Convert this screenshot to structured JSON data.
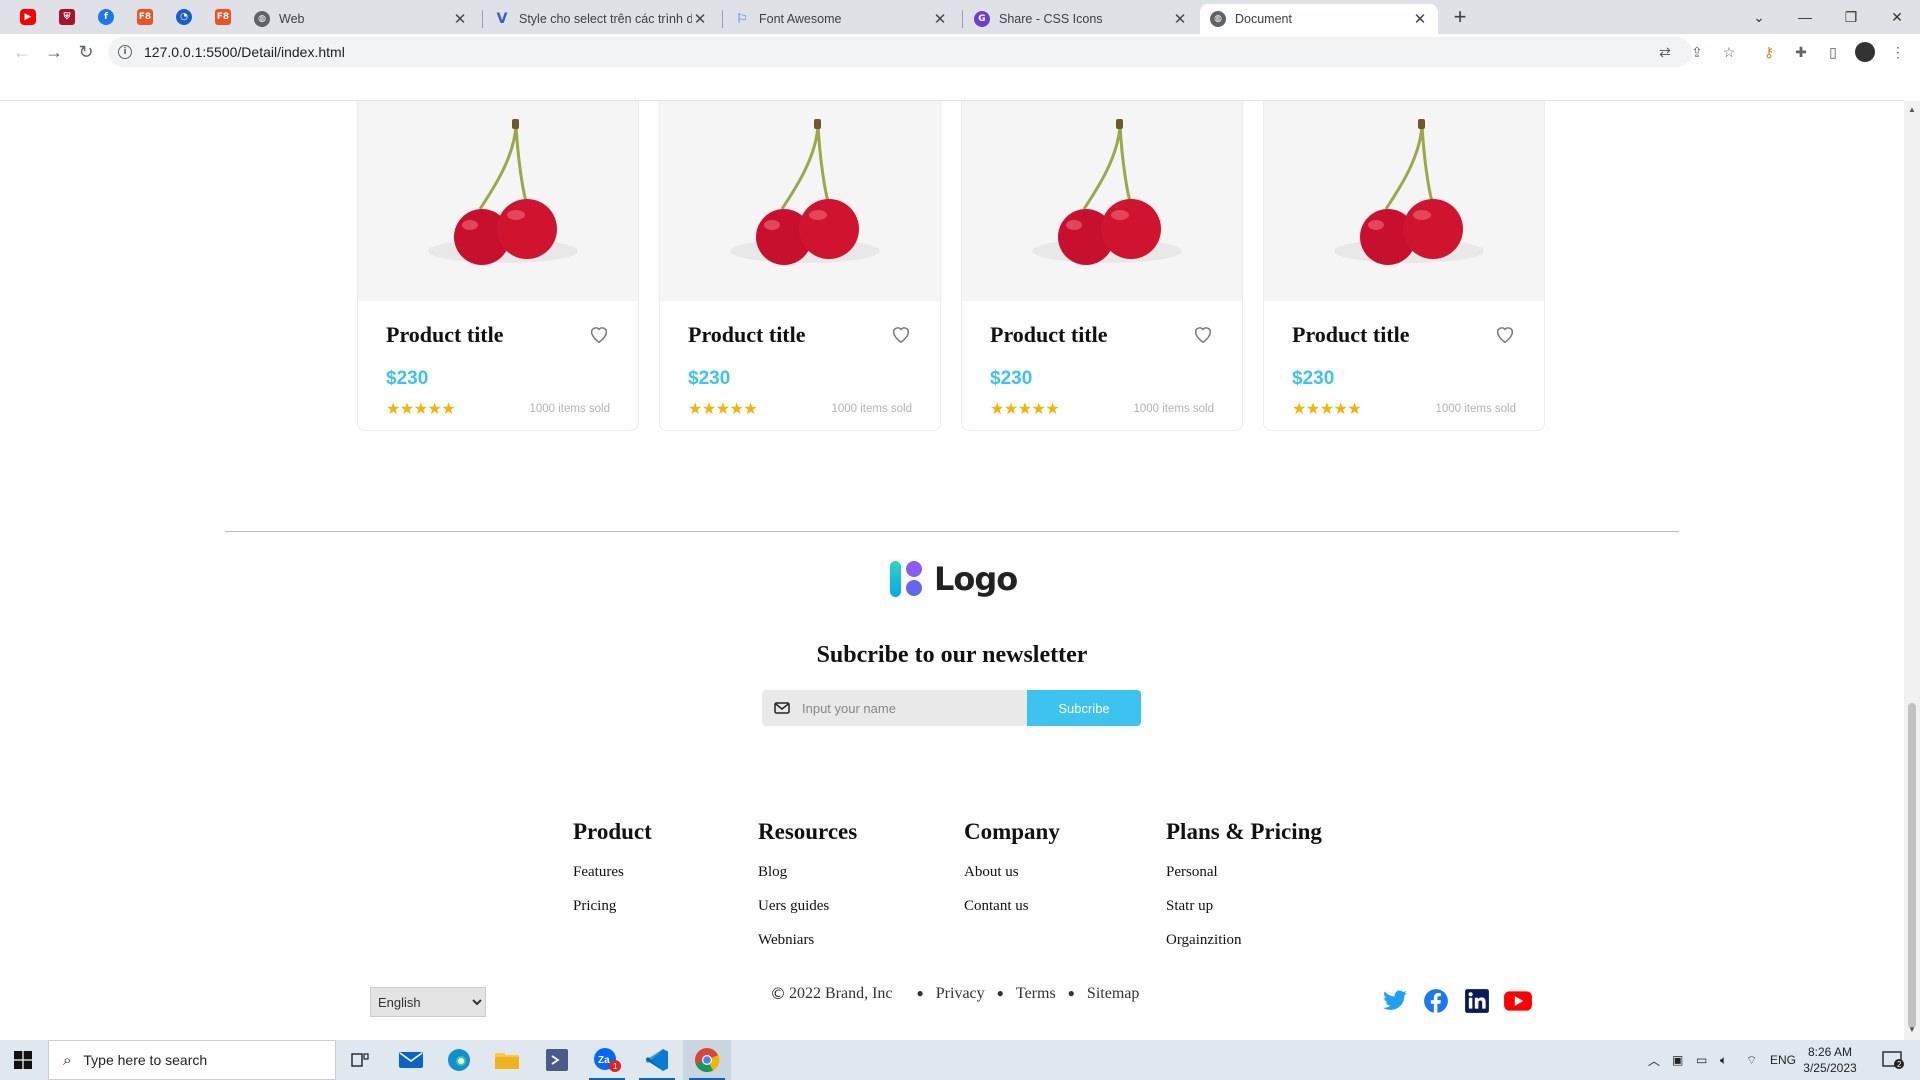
{
  "browser": {
    "tabs": [
      {
        "title": "Web",
        "icon": "globe-icon"
      },
      {
        "title": "Style cho select trên các trình duyệt",
        "icon": "v-logo-icon"
      },
      {
        "title": "Font Awesome",
        "icon": "flag-icon"
      },
      {
        "title": "Share - CSS Icons",
        "icon": "css-icons-icon"
      },
      {
        "title": "Document",
        "icon": "globe-icon"
      }
    ],
    "pinned_tabs": [
      "youtube-icon",
      "shield-icon",
      "facebook-icon",
      "f8-icon",
      "messenger-icon",
      "f8-icon"
    ],
    "url": "127.0.0.1:5500/Detail/index.html"
  },
  "products": [
    {
      "title": "Product title",
      "price": "$230",
      "stars": "★★★★★",
      "rating": 5,
      "sold": "1000 items sold"
    },
    {
      "title": "Product title",
      "price": "$230",
      "stars": "★★★★★",
      "rating": 5,
      "sold": "1000 items sold"
    },
    {
      "title": "Product title",
      "price": "$230",
      "stars": "★★★★★",
      "rating": 5,
      "sold": "1000 items sold"
    },
    {
      "title": "Product title",
      "price": "$230",
      "stars": "★★★★★",
      "rating": 5,
      "sold": "1000 items sold"
    }
  ],
  "footer": {
    "logo_text": "Logo",
    "newsletter": {
      "title": "Subcribe to our newsletter",
      "placeholder": "Input your name",
      "button": "Subcribe"
    },
    "columns": [
      {
        "heading": "Product",
        "links": [
          "Features",
          "Pricing"
        ]
      },
      {
        "heading": "Resources",
        "links": [
          "Blog",
          "Uers guides",
          "Webniars"
        ]
      },
      {
        "heading": "Company",
        "links": [
          "About us",
          "Contant us"
        ]
      },
      {
        "heading": "Plans & Pricing",
        "links": [
          "Personal",
          "Statr up",
          "Orgainzition"
        ]
      }
    ],
    "language": "English",
    "copyright": "2022 Brand, Inc",
    "legal_links": [
      "Privacy",
      "Terms",
      "Sitemap"
    ],
    "social": [
      "twitter-icon",
      "facebook-icon",
      "linkedin-icon",
      "youtube-icon"
    ],
    "colors": {
      "accent": "#3cc3f0",
      "star": "#f4b400"
    }
  },
  "taskbar": {
    "search_placeholder": "Type here to search",
    "language": "ENG",
    "time": "8:26 AM",
    "date": "3/25/2023",
    "notification_count": "2"
  }
}
